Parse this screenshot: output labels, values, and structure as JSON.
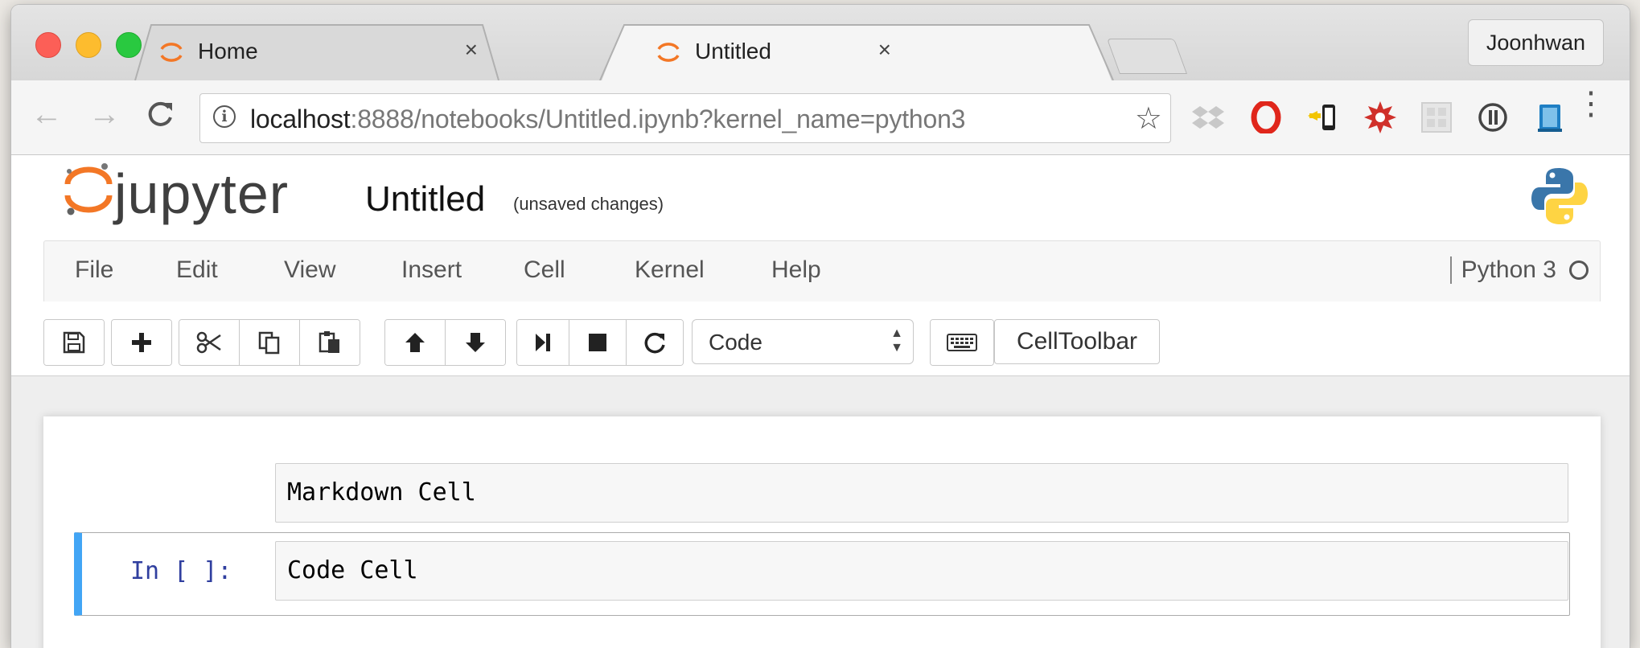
{
  "browser": {
    "tabs": [
      {
        "title": "Home",
        "close": "×",
        "active": false
      },
      {
        "title": "Untitled",
        "close": "×",
        "active": true
      }
    ],
    "profile": "Joonhwan",
    "nav": {
      "back": "←",
      "forward": "→",
      "reload": "C"
    },
    "url": {
      "host": "localhost",
      "rest": ":8888/notebooks/Untitled.ipynb?kernel_name=python3"
    },
    "info_glyph": "i",
    "star_glyph": "☆",
    "menu_glyph": "⋮",
    "extensions": [
      "dropbox-icon",
      "opera-icon",
      "cast-to-phone-icon",
      "red-badge-icon",
      "grid-icon",
      "pause-circle-icon",
      "blue-book-icon"
    ]
  },
  "jupyter": {
    "wordmark": "jupyter",
    "notebook_name": "Untitled",
    "save_status": "(unsaved changes)",
    "menu": [
      "File",
      "Edit",
      "View",
      "Insert",
      "Cell",
      "Kernel",
      "Help"
    ],
    "kernel_name": "Python 3",
    "toolbar": {
      "cell_type": "Code",
      "celltoolbar_label": "CellToolbar",
      "buttons": [
        "save",
        "insert-below",
        "cut",
        "copy",
        "paste",
        "move-up",
        "move-down",
        "run",
        "interrupt",
        "restart",
        "keyboard"
      ]
    },
    "cells": {
      "markdown_text": "Markdown Cell",
      "code_prompt": "In [ ]:",
      "code_text": "Code Cell"
    }
  },
  "colors": {
    "jupyter_orange": "#f37726",
    "active_cell_bar": "#42a5f5",
    "prompt_blue": "#303f9f"
  }
}
